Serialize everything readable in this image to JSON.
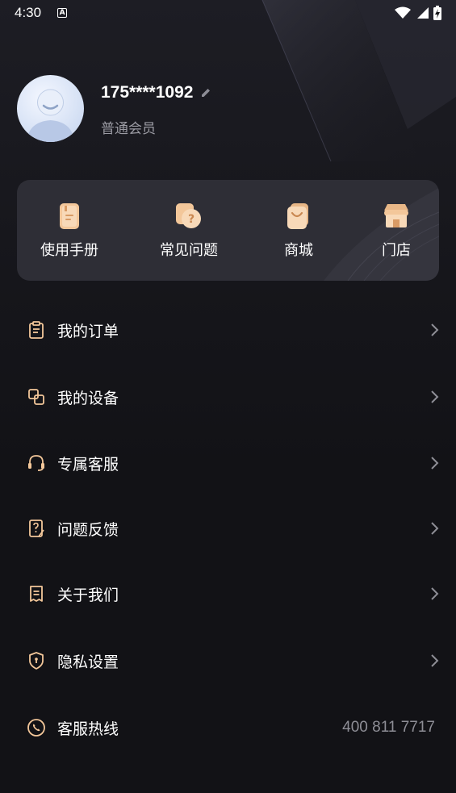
{
  "status_bar": {
    "time": "4:30",
    "a_label": "A"
  },
  "profile": {
    "phone": "175****1092",
    "member_level": "普通会员"
  },
  "quick_actions": [
    {
      "label": "使用手册",
      "icon": "manual-icon"
    },
    {
      "label": "常见问题",
      "icon": "faq-icon"
    },
    {
      "label": "商城",
      "icon": "shop-bag-icon"
    },
    {
      "label": "门店",
      "icon": "store-icon"
    }
  ],
  "menu": [
    {
      "label": "我的订单",
      "icon": "order-icon"
    },
    {
      "label": "我的设备",
      "icon": "device-icon"
    },
    {
      "label": "专属客服",
      "icon": "headset-icon"
    },
    {
      "label": "问题反馈",
      "icon": "feedback-icon"
    },
    {
      "label": "关于我们",
      "icon": "about-icon"
    },
    {
      "label": "隐私设置",
      "icon": "privacy-shield-icon"
    },
    {
      "label": "客服热线",
      "icon": "phone-icon",
      "value": "400 811 7717"
    }
  ],
  "colors": {
    "accent": "#f3c79a",
    "background": "#121216",
    "card": "#2e2e36"
  }
}
